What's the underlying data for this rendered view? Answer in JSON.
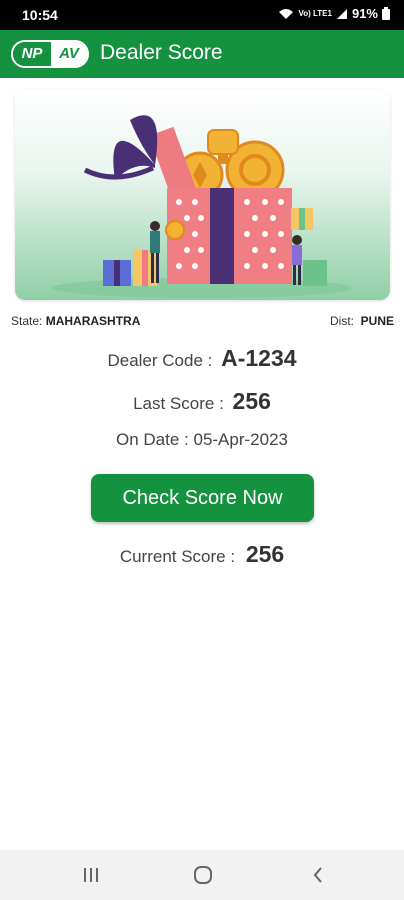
{
  "status_bar": {
    "time": "10:54",
    "battery": "91%",
    "network": "Vo) LTE1"
  },
  "app_bar": {
    "logo_np": "NP",
    "logo_av": "AV",
    "title": "Dealer Score"
  },
  "location": {
    "state_label": "State:",
    "state_value": "MAHARASHTRA",
    "dist_label": "Dist:",
    "dist_value": "PUNE"
  },
  "dealer": {
    "code_label": "Dealer Code :",
    "code_value": "A-1234"
  },
  "last": {
    "label": "Last Score :",
    "value": "256"
  },
  "date": {
    "label": "On Date :",
    "value": "05-Apr-2023"
  },
  "button": {
    "label": "Check Score Now"
  },
  "current": {
    "label": "Current Score :",
    "value": "256"
  },
  "nav": {
    "recent": "recents-icon",
    "home": "home-icon",
    "back": "back-icon"
  },
  "colors": {
    "brand_green": "#15923f"
  }
}
